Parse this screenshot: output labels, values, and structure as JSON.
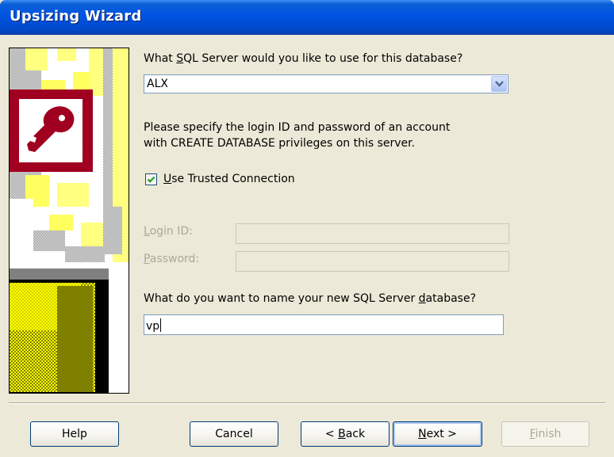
{
  "window": {
    "title": "Upsizing Wizard"
  },
  "server": {
    "question_pre": "What ",
    "question_key": "S",
    "question_post": "QL Server would you like to use for this database?",
    "selected": "ALX"
  },
  "login_instructions": {
    "line1": "Please specify the login ID and password of an account",
    "line2": "with CREATE DATABASE privileges on this server."
  },
  "trusted": {
    "key": "U",
    "label_rest": "se Trusted Connection",
    "checked": true
  },
  "login_id": {
    "key": "L",
    "label_rest": "ogin ID:",
    "value": ""
  },
  "password": {
    "key": "P",
    "label_rest": "assword:",
    "value": ""
  },
  "database": {
    "question_pre": "What do you want to name your new SQL Server ",
    "question_key": "d",
    "question_post": "atabase?",
    "value": "vp"
  },
  "buttons": {
    "help": "Help",
    "cancel": "Cancel",
    "back_pre": "< ",
    "back_key": "B",
    "back_post": "ack",
    "next_key": "N",
    "next_post": "ext >",
    "finish_key": "F",
    "finish_post": "inish"
  }
}
